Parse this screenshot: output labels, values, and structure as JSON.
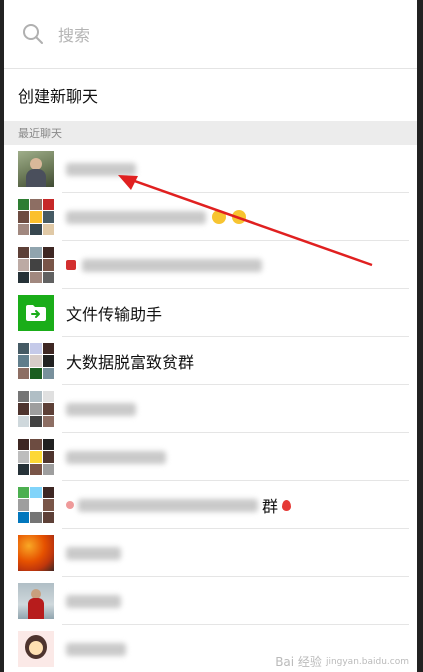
{
  "search": {
    "placeholder": "搜索",
    "icon": "search-icon"
  },
  "new_chat": {
    "label": "创建新聊天"
  },
  "section": {
    "title": "最近聊天"
  },
  "chats": [
    {
      "name": "",
      "avatar": "photo-person",
      "blurred": true
    },
    {
      "name": "",
      "avatar": "group-grid",
      "blurred": true
    },
    {
      "name": "",
      "avatar": "group-grid",
      "blurred": true
    },
    {
      "name": "文件传输助手",
      "avatar": "file-transfer-icon",
      "blurred": false
    },
    {
      "name": "大数据脱富致贫群",
      "avatar": "group-grid",
      "blurred": false
    },
    {
      "name": "",
      "avatar": "group-grid",
      "blurred": true
    },
    {
      "name": "",
      "avatar": "group-grid",
      "blurred": true
    },
    {
      "name": "群",
      "avatar": "group-grid",
      "blurred": true
    },
    {
      "name": "",
      "avatar": "photo-leaves",
      "blurred": true
    },
    {
      "name": "",
      "avatar": "photo-person",
      "blurred": true
    },
    {
      "name": "",
      "avatar": "photo-cartoon",
      "blurred": true
    }
  ],
  "watermark": {
    "text": "Bai 经验",
    "sub": "jingyan.baidu.com"
  },
  "colors": {
    "accent_green": "#1aad19",
    "arrow_red": "#e02020"
  }
}
